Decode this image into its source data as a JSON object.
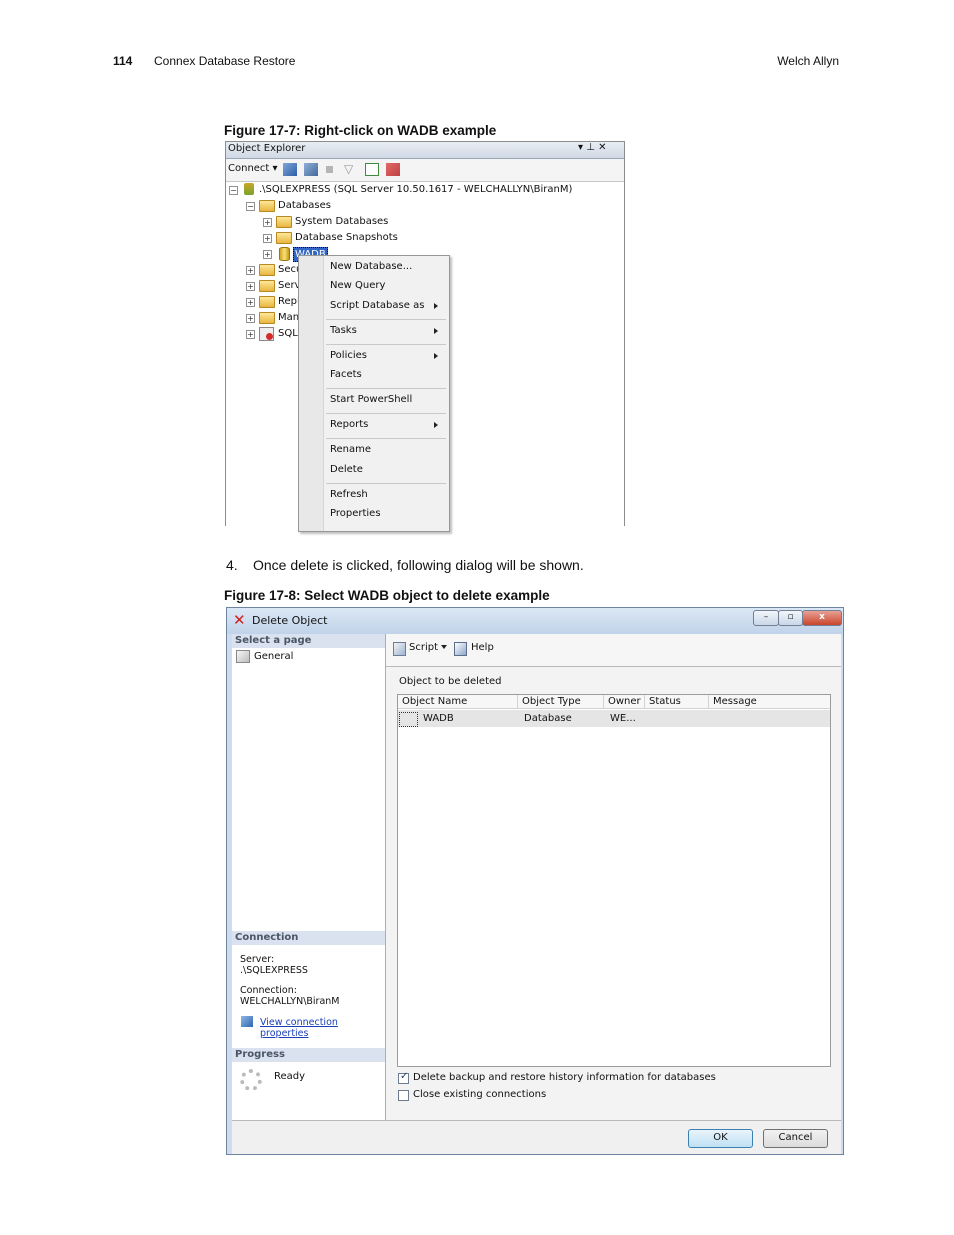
{
  "header": {
    "page_number": "114",
    "doc_title": "Connex Database Restore",
    "brand": "Welch Allyn"
  },
  "fig1": {
    "caption": "Figure 17-7: Right-click on WADB example",
    "panel_title": "Object Explorer",
    "pin_glyph": "▾ ⊥ ✕",
    "connect_label": "Connect ▾",
    "tree": {
      "server": ".\\SQLEXPRESS (SQL Server 10.50.1617 - WELCHALLYN\\BiranM)",
      "databases": "Databases",
      "system_databases": "System Databases",
      "database_snapshots": "Database Snapshots",
      "wadb": "WADB",
      "truncated": [
        "Secu",
        "Serv",
        "Repl",
        "Man",
        "SQL"
      ]
    },
    "menu": [
      "New Database...",
      "New Query",
      "Script Database as",
      "Tasks",
      "Policies",
      "Facets",
      "Start PowerShell",
      "Reports",
      "Rename",
      "Delete",
      "Refresh",
      "Properties"
    ]
  },
  "step": {
    "number": "4.",
    "text": "Once delete is clicked, following dialog will be shown."
  },
  "fig2": {
    "caption": "Figure 17-8: Select WADB object to delete example",
    "title": "Delete Object",
    "win_controls": {
      "min": "–",
      "max": "▫",
      "close": "x"
    },
    "select_page": "Select a page",
    "general": "General",
    "connection_head": "Connection",
    "server_label": "Server:",
    "server_value": ".\\SQLEXPRESS",
    "connection_label": "Connection:",
    "connection_value": "WELCHALLYN\\BiranM",
    "view_props": "View connection properties",
    "progress_head": "Progress",
    "progress_status": "Ready",
    "script_label": "Script",
    "help_label": "Help",
    "object_label": "Object to be deleted",
    "columns": [
      "Object Name",
      "Object Type",
      "Owner",
      "Status",
      "Message"
    ],
    "row": {
      "name": "WADB",
      "type": "Database",
      "owner": "WE...",
      "status": "",
      "message": ""
    },
    "opt1": "Delete backup and restore history information for databases",
    "opt2": "Close existing connections",
    "ok": "OK",
    "cancel": "Cancel"
  }
}
